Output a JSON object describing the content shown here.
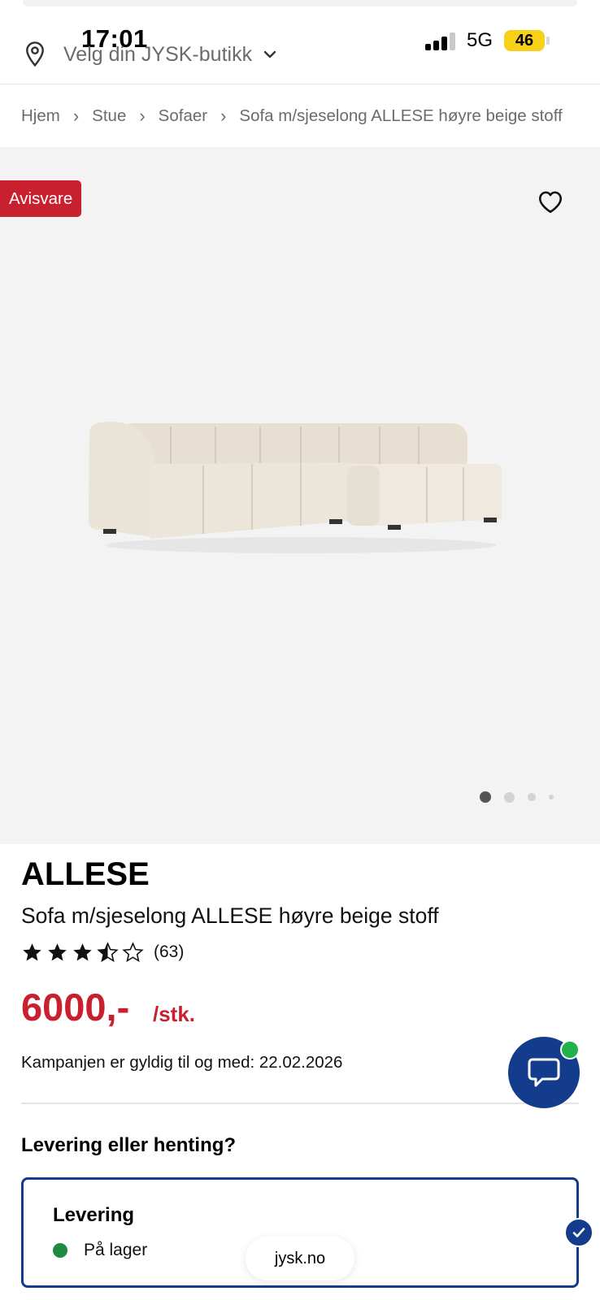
{
  "status_bar": {
    "time": "17:01",
    "network": "5G",
    "battery": "46"
  },
  "header": {
    "store_label": "Velg din JYSK-butikk"
  },
  "breadcrumb": [
    "Hjem",
    "Stue",
    "Sofaer",
    "Sofa m/sjeselong ALLESE høyre beige stoff"
  ],
  "gallery": {
    "badge": "Avisvare",
    "slides": 4,
    "active_slide": 1
  },
  "product": {
    "name": "ALLESE",
    "description": "Sofa m/sjeselong ALLESE høyre beige stoff",
    "rating": 3.5,
    "rating_max": 5,
    "rating_count": "(63)",
    "price": "6000,-",
    "unit": "/stk.",
    "campaign": "Kampanjen er gyldig til og med: 22.02.2026"
  },
  "delivery": {
    "heading": "Levering eller henting?",
    "option_title": "Levering",
    "stock_status": "På lager",
    "selected": true
  },
  "browser": {
    "url": "jysk.no"
  },
  "colors": {
    "accent_red": "#c8202e",
    "brand_blue": "#143c8c",
    "stock_green": "#1f8a43",
    "battery_yellow": "#f7d117"
  },
  "icons": {
    "location": "location-pin-icon",
    "dropdown": "chevron-down-icon",
    "favorite": "heart-icon",
    "chat": "chat-bubble-icon",
    "selected": "checkmark-icon"
  }
}
